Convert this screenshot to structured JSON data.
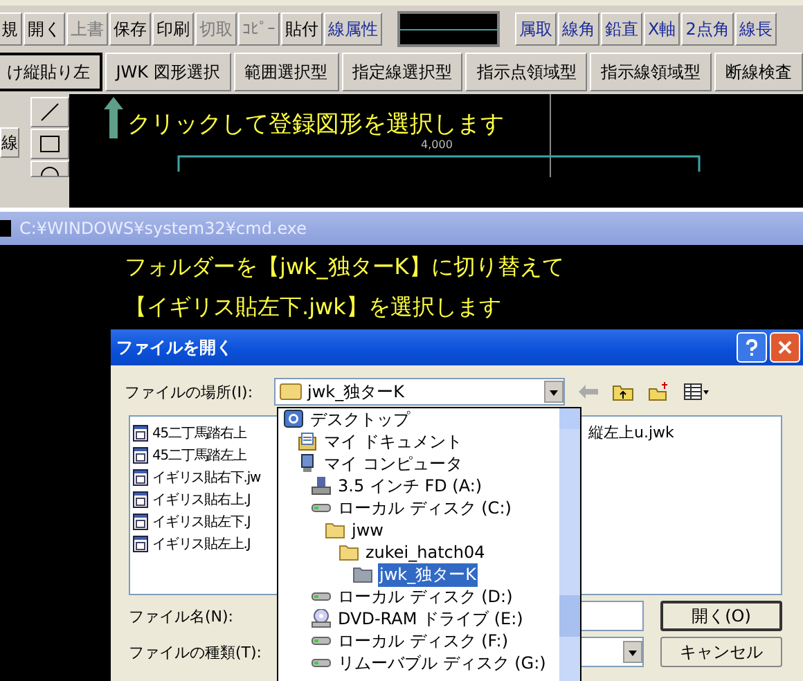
{
  "toolbar_1": [
    {
      "kind": "button",
      "label": "規",
      "disabled": false
    },
    {
      "kind": "button",
      "label": "開く",
      "disabled": false
    },
    {
      "kind": "button",
      "label": "上書",
      "disabled": true
    },
    {
      "kind": "button",
      "label": "保存",
      "disabled": false
    },
    {
      "kind": "button",
      "label": "印刷",
      "disabled": false
    },
    {
      "kind": "button",
      "label": "切取",
      "disabled": true
    },
    {
      "kind": "button",
      "label": "ｺﾋﾟｰ",
      "disabled": true
    },
    {
      "kind": "button",
      "label": "貼付",
      "disabled": false
    },
    {
      "kind": "blue",
      "label": "線属性",
      "disabled": false
    },
    {
      "kind": "line-sample",
      "disabled": false
    },
    {
      "kind": "blue",
      "label": "属取",
      "disabled": false
    },
    {
      "kind": "blue",
      "label": "線角",
      "disabled": false
    },
    {
      "kind": "blue",
      "label": "鉛直",
      "disabled": false
    },
    {
      "kind": "blue",
      "label": "X軸",
      "disabled": false
    },
    {
      "kind": "blue",
      "label": "2点角",
      "disabled": false
    },
    {
      "kind": "blue",
      "label": "線長",
      "disabled": false
    }
  ],
  "toolbar_2": [
    {
      "label": "け縦貼り左",
      "selected": true
    },
    {
      "label": "JWK 図形選択",
      "selected": false
    },
    {
      "label": "範囲選択型",
      "selected": false
    },
    {
      "label": "指定線選択型",
      "selected": false
    },
    {
      "label": "指示点領域型",
      "selected": false
    },
    {
      "label": "指示線領域型",
      "selected": false
    },
    {
      "label": "断線検査",
      "selected": false
    }
  ],
  "side_tools": [
    {
      "kind": "label",
      "label": "線"
    },
    {
      "kind": "line"
    },
    {
      "kind": "rect"
    },
    {
      "kind": "circle"
    }
  ],
  "canvas": {
    "instruction": "クリックして登録図形を選択します",
    "dimension": "4,000"
  },
  "console": {
    "title": "C:¥WINDOWS¥system32¥cmd.exe",
    "lines": [
      "フォルダーを【jwk_独ターK】に切り替えて",
      "【イギリス貼左下.jwk】を選択します"
    ]
  },
  "dialog": {
    "title": "ファイルを開く",
    "location_label": "ファイルの場所(I):",
    "location": "jwk_独ターK",
    "files": [
      "45二丁馬踏右上",
      "45二丁馬踏左上",
      "イギリス貼右下.jw",
      "イギリス貼右上.J",
      "イギリス貼左下.J",
      "イギリス貼左上.J"
    ],
    "files_column_2": [
      "縦左上u.jwk"
    ],
    "filename_label": "ファイル名(N):",
    "filetype_label": "ファイルの種類(T):",
    "buttons": [
      {
        "label": "開く(O)",
        "default": true
      },
      {
        "label": "キャンセル",
        "default": false
      }
    ],
    "location_list": [
      {
        "kind": "desktop",
        "label": "デスクトップ",
        "selected": false,
        "children": [
          {
            "kind": "documents",
            "label": "マイ ドキュメント",
            "selected": false
          },
          {
            "kind": "computer",
            "label": "マイ コンピュータ",
            "selected": false,
            "children": [
              {
                "kind": "floppy",
                "label": "3.5 インチ FD (A:)",
                "selected": false
              },
              {
                "kind": "disk",
                "label": "ローカル ディスク (C:)",
                "selected": false,
                "children": [
                  {
                    "kind": "folder",
                    "label": "jww",
                    "selected": false,
                    "children": [
                      {
                        "kind": "folder",
                        "label": "zukei_hatch04",
                        "selected": false,
                        "children": [
                          {
                            "kind": "folder",
                            "label": "jwk_独ターK",
                            "selected": true
                          }
                        ]
                      }
                    ]
                  }
                ]
              },
              {
                "kind": "disk",
                "label": "ローカル ディスク (D:)",
                "selected": false
              },
              {
                "kind": "dvd",
                "label": "DVD-RAM ドライブ (E:)",
                "selected": false
              },
              {
                "kind": "disk",
                "label": "ローカル ディスク (F:)",
                "selected": false
              },
              {
                "kind": "disk",
                "label": "リムーバブル ディスク (G:)",
                "selected": false
              }
            ]
          }
        ]
      }
    ]
  }
}
